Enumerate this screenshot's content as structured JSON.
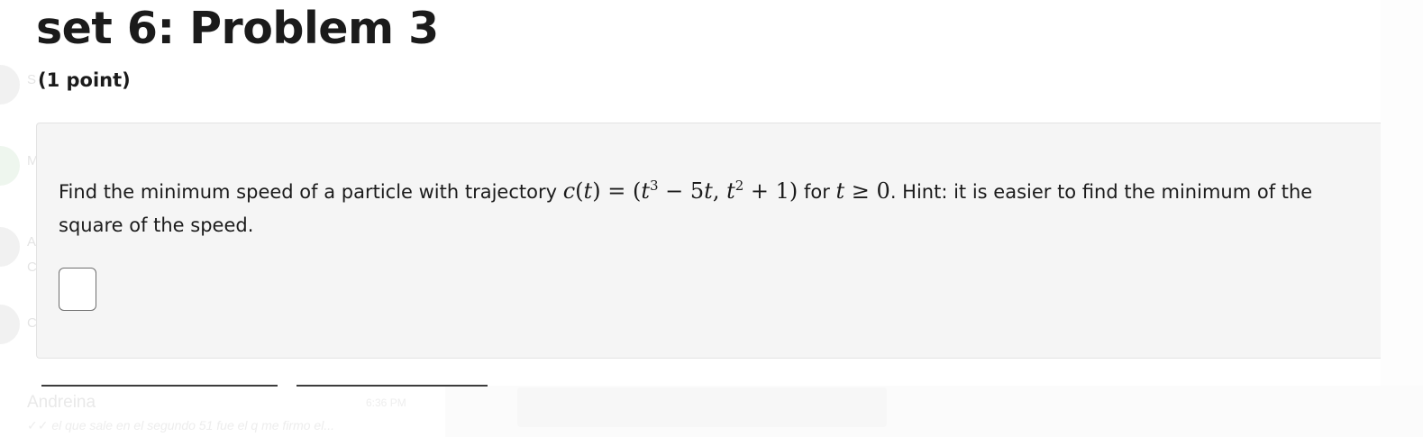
{
  "header": {
    "title": "set 6: Problem 3",
    "points": "(1 point)"
  },
  "problem": {
    "text_before": "Find the minimum speed of a particle with trajectory ",
    "text_for": " for ",
    "text_after": ". Hint: it is easier to find the minimum of the square of the speed.",
    "math": {
      "func_c": "c",
      "func_t": "t",
      "eq": " = (",
      "t1": "t",
      "exp3": "3",
      "minus": " − 5",
      "t2": "t",
      "comma": ", ",
      "t3": "t",
      "exp2": "2",
      "plus_one": " + 1)",
      "cond_t": "t",
      "cond_rel": " ≥ 0"
    },
    "answer": {
      "value": "",
      "placeholder": ""
    }
  },
  "background": {
    "letters": [
      "S",
      "M",
      "A",
      "C",
      "C"
    ],
    "chat_name": "Andreina",
    "chat_time": "6:36 PM",
    "chat_preview": "✓✓ el que sale en el segundo 51 fue el q me firmo el..."
  },
  "colors": {
    "box_background": "#f5f5f5",
    "box_border": "#e3e3e3",
    "text": "#1b1b1b",
    "input_border": "#6f6f6f"
  }
}
